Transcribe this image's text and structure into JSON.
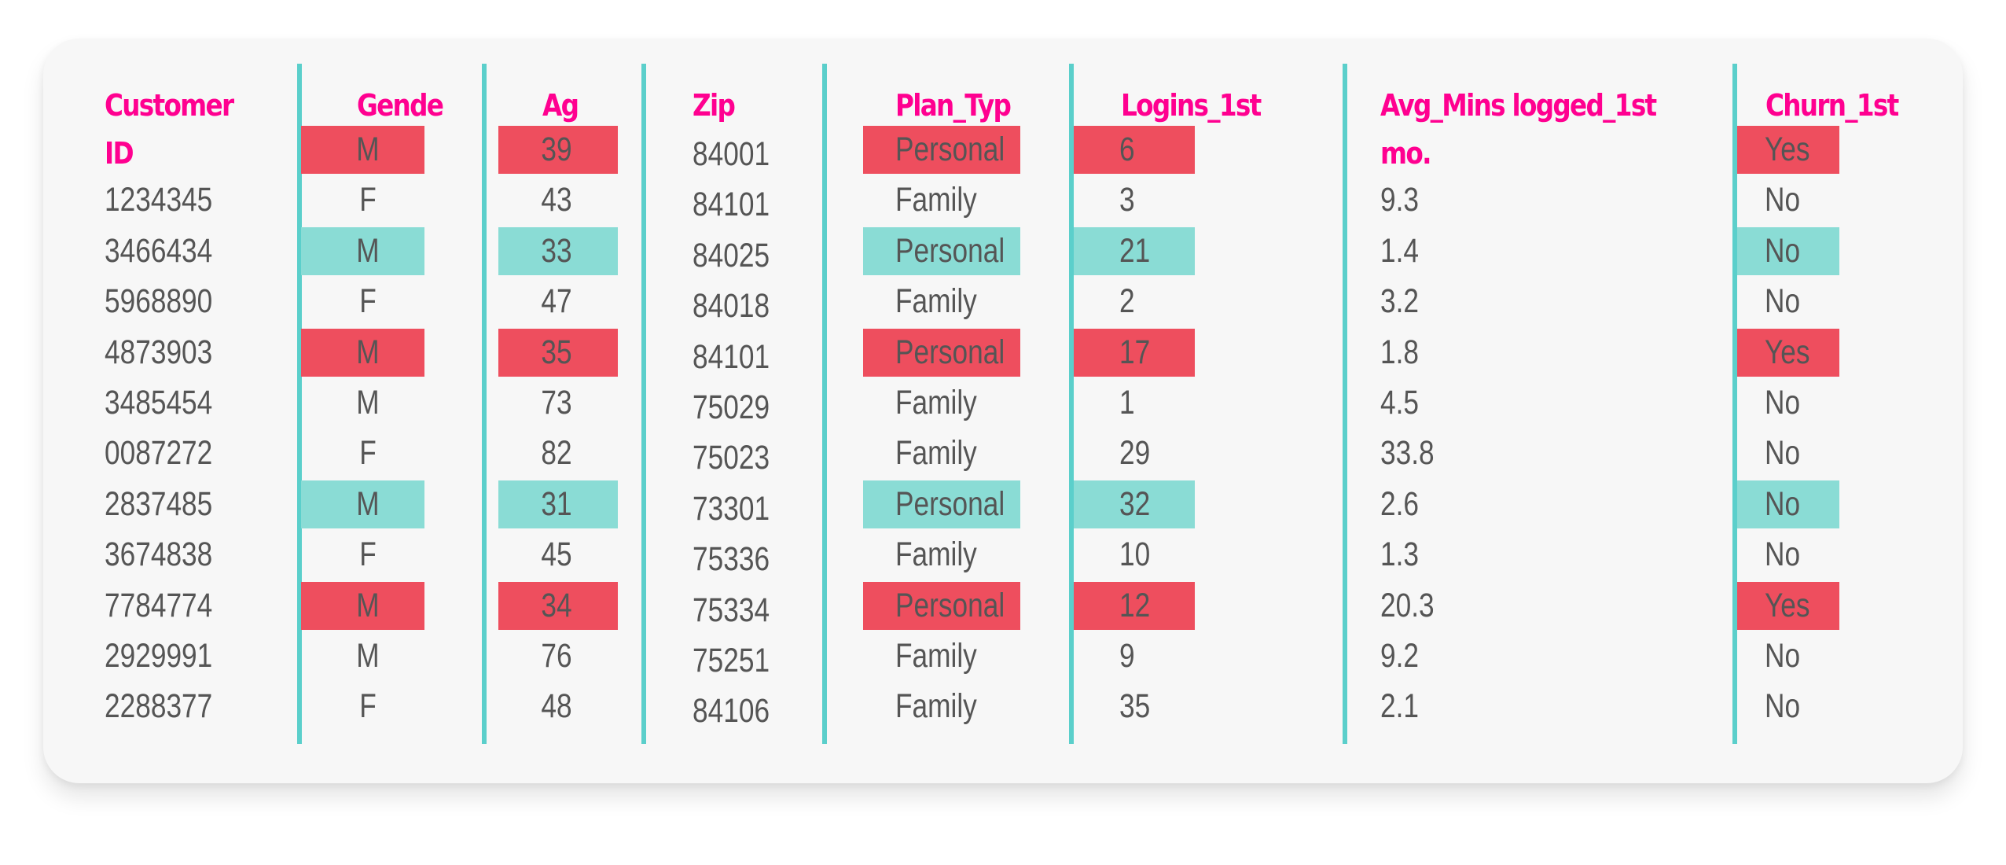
{
  "colors": {
    "header_text": "#ff0090",
    "body_text": "#555555",
    "divider": "#5bcfcb",
    "highlight_red": "#ee4e5e",
    "highlight_teal": "#8adcd5",
    "card_bg": "#f7f7f7"
  },
  "table": {
    "headers": {
      "customer_id_line1": "Customer",
      "customer_id_line2": "ID",
      "gender": "Gende",
      "age": "Ag",
      "zip": "Zip",
      "plan_type": "Plan_Typ",
      "logins": "Logins_1st",
      "avg_mins_line1": "Avg_Mins logged_1st",
      "avg_mins_line2": "mo.",
      "churn": "Churn_1st"
    },
    "rows": [
      {
        "customer_id": "",
        "gender": "M",
        "age": "39",
        "zip": "84001",
        "plan_type": "Personal",
        "logins": "6",
        "avg_mins": "",
        "churn": "Yes",
        "highlight": "red"
      },
      {
        "customer_id": "1234345",
        "gender": "F",
        "age": "43",
        "zip": "84101",
        "plan_type": "Family",
        "logins": "3",
        "avg_mins": "9.3",
        "churn": "No",
        "highlight": "none"
      },
      {
        "customer_id": "3466434",
        "gender": "M",
        "age": "33",
        "zip": "84025",
        "plan_type": "Personal",
        "logins": "21",
        "avg_mins": "1.4",
        "churn": "No",
        "highlight": "teal"
      },
      {
        "customer_id": "5968890",
        "gender": "F",
        "age": "47",
        "zip": "84018",
        "plan_type": "Family",
        "logins": "2",
        "avg_mins": "3.2",
        "churn": "No",
        "highlight": "none"
      },
      {
        "customer_id": "4873903",
        "gender": "M",
        "age": "35",
        "zip": "84101",
        "plan_type": "Personal",
        "logins": "17",
        "avg_mins": "1.8",
        "churn": "Yes",
        "highlight": "red"
      },
      {
        "customer_id": "3485454",
        "gender": "M",
        "age": "73",
        "zip": "75029",
        "plan_type": "Family",
        "logins": "1",
        "avg_mins": "4.5",
        "churn": "No",
        "highlight": "none"
      },
      {
        "customer_id": "0087272",
        "gender": "F",
        "age": "82",
        "zip": "75023",
        "plan_type": "Family",
        "logins": "29",
        "avg_mins": "33.8",
        "churn": "No",
        "highlight": "none"
      },
      {
        "customer_id": "2837485",
        "gender": "M",
        "age": "31",
        "zip": "73301",
        "plan_type": "Personal",
        "logins": "32",
        "avg_mins": "2.6",
        "churn": "No",
        "highlight": "teal"
      },
      {
        "customer_id": "3674838",
        "gender": "F",
        "age": "45",
        "zip": "75336",
        "plan_type": "Family",
        "logins": "10",
        "avg_mins": "1.3",
        "churn": "No",
        "highlight": "none"
      },
      {
        "customer_id": "7784774",
        "gender": "M",
        "age": "34",
        "zip": "75334",
        "plan_type": "Personal",
        "logins": "12",
        "avg_mins": "20.3",
        "churn": "Yes",
        "highlight": "red"
      },
      {
        "customer_id": "2929991",
        "gender": "M",
        "age": "76",
        "zip": "75251",
        "plan_type": "Family",
        "logins": "9",
        "avg_mins": "9.2",
        "churn": "No",
        "highlight": "none"
      },
      {
        "customer_id": "2288377",
        "gender": "F",
        "age": "48",
        "zip": "84106",
        "plan_type": "Family",
        "logins": "35",
        "avg_mins": "2.1",
        "churn": "No",
        "highlight": "none"
      }
    ]
  }
}
